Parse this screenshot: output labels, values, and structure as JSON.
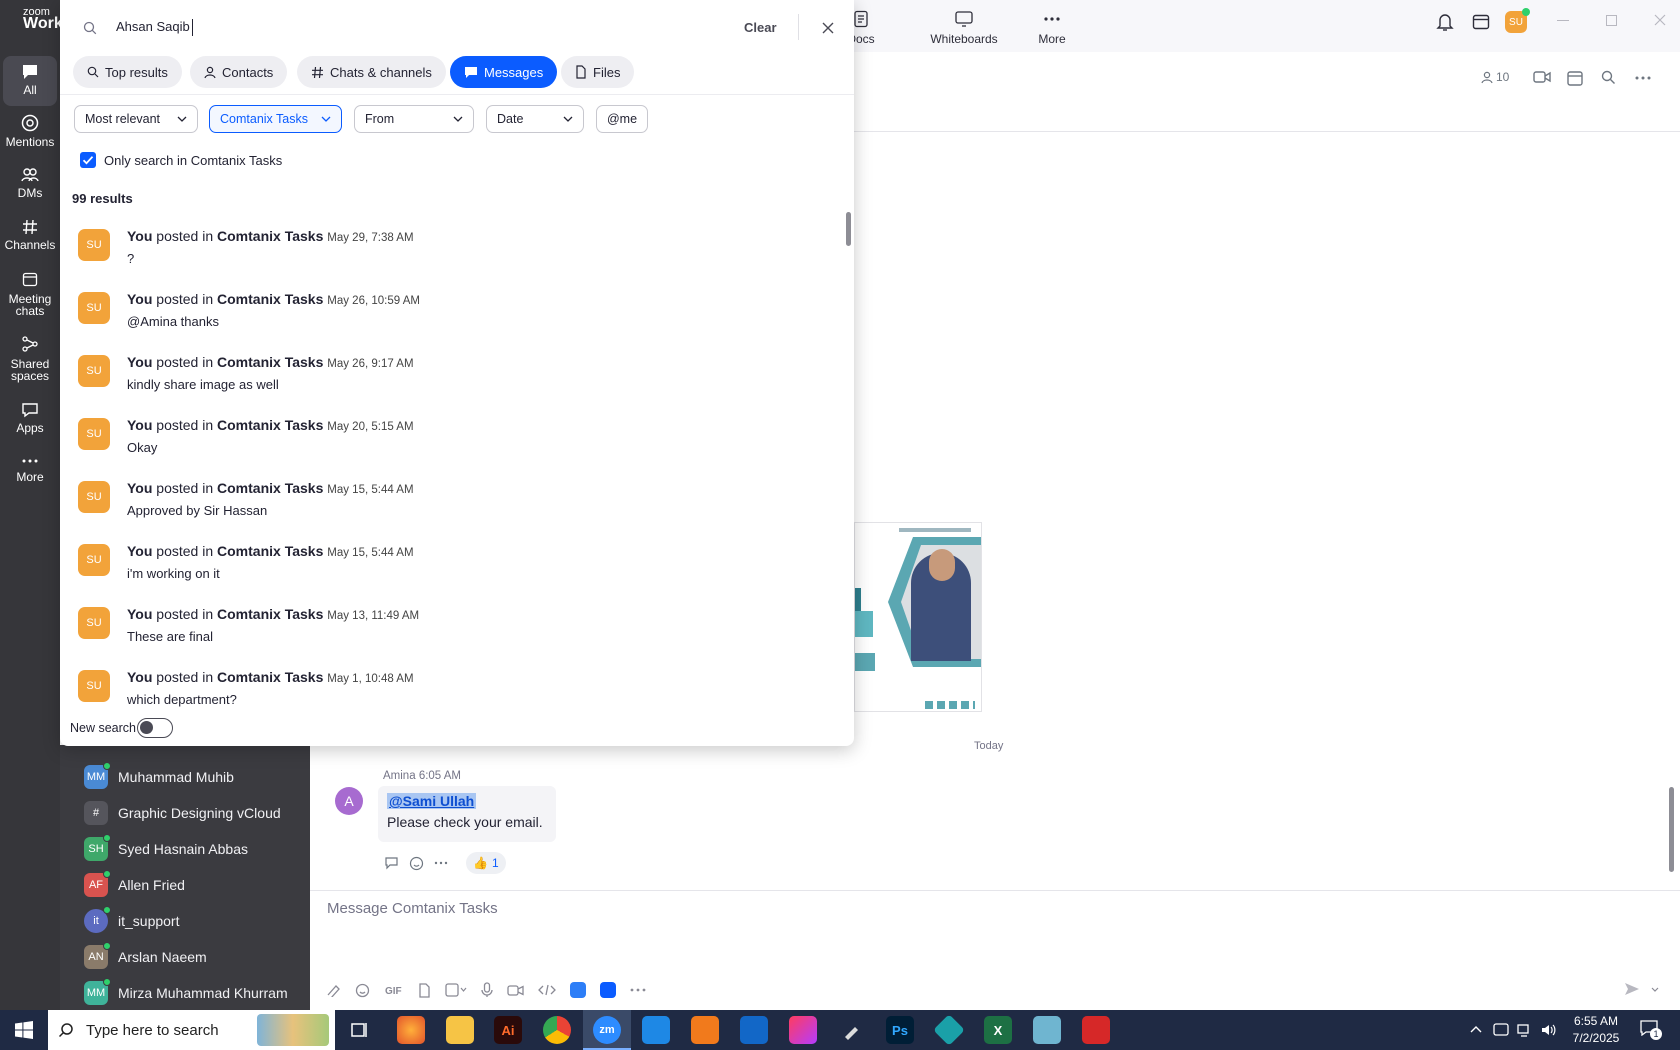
{
  "app": {
    "brand_small": "zoom",
    "brand_large": "Work"
  },
  "sidebar": {
    "items": [
      {
        "label": "All",
        "icon": "chat-bubble-icon"
      },
      {
        "label": "Mentions",
        "icon": "at-icon"
      },
      {
        "label": "DMs",
        "icon": "people-icon"
      },
      {
        "label": "Channels",
        "icon": "hash-icon"
      },
      {
        "label": "Meeting",
        "label2": "chats",
        "icon": "calendar-icon"
      },
      {
        "label": "Shared",
        "label2": "spaces",
        "icon": "share-icon"
      },
      {
        "label": "Apps",
        "icon": "apps-icon"
      },
      {
        "label": "More",
        "icon": "more-dots-icon"
      }
    ]
  },
  "topbar": {
    "docs": "Docs",
    "whiteboards": "Whiteboards",
    "more": "More",
    "avatar": "SU",
    "participants": "10"
  },
  "search": {
    "query": "Ahsan Saqib",
    "clear": "Clear",
    "tabs": [
      "Top results",
      "Contacts",
      "Chats & channels",
      "Messages",
      "Files"
    ],
    "filters": [
      "Most relevant",
      "Comtanix Tasks",
      "From",
      "Date",
      "@me"
    ],
    "only_search": "Only search in Comtanix Tasks",
    "result_count": "99 results",
    "new_search": "New search",
    "results": [
      {
        "avatar": "SU",
        "author": "You",
        "verb": "posted in",
        "channel": "Comtanix Tasks",
        "time": "May 29, 7:38 AM",
        "text": "?"
      },
      {
        "avatar": "SU",
        "author": "You",
        "verb": "posted in",
        "channel": "Comtanix Tasks",
        "time": "May 26, 10:59 AM",
        "text": "@Amina thanks"
      },
      {
        "avatar": "SU",
        "author": "You",
        "verb": "posted in",
        "channel": "Comtanix Tasks",
        "time": "May 26, 9:17 AM",
        "text": "kindly share image as well"
      },
      {
        "avatar": "SU",
        "author": "You",
        "verb": "posted in",
        "channel": "Comtanix Tasks",
        "time": "May 20, 5:15 AM",
        "text": "Okay"
      },
      {
        "avatar": "SU",
        "author": "You",
        "verb": "posted in",
        "channel": "Comtanix Tasks",
        "time": "May 15, 5:44 AM",
        "text": "Approved by Sir Hassan"
      },
      {
        "avatar": "SU",
        "author": "You",
        "verb": "posted in",
        "channel": "Comtanix Tasks",
        "time": "May 15, 5:44 AM",
        "text": "i'm working on it"
      },
      {
        "avatar": "SU",
        "author": "You",
        "verb": "posted in",
        "channel": "Comtanix Tasks",
        "time": "May 13, 11:49 AM",
        "text": "These are final"
      },
      {
        "avatar": "SU",
        "author": "You",
        "verb": "posted in",
        "channel": "Comtanix Tasks",
        "time": "May 1, 10:48 AM",
        "text": "which department?"
      }
    ]
  },
  "channels": [
    {
      "name": "Muhammad Muhib",
      "avatar": "MM",
      "color": "#4a8ad4"
    },
    {
      "name": "Graphic Designing vCloud",
      "avatar": "#",
      "color": "#55555c"
    },
    {
      "name": "Syed Hasnain Abbas",
      "avatar": "SH",
      "color": "#3fa86a"
    },
    {
      "name": "Allen Fried",
      "avatar": "AF",
      "color": "#d9534f"
    },
    {
      "name": "it_support",
      "avatar": "it",
      "color": "#5c6bc0"
    },
    {
      "name": "Arslan Naeem",
      "avatar": "AN",
      "color": "#8a7b6a"
    },
    {
      "name": "Mirza Muhammad Khurram",
      "avatar": "MM",
      "color": "#3fb39a"
    }
  ],
  "chat": {
    "date_divider": "Today",
    "message": {
      "author": "Amina",
      "time": "6:05 AM",
      "avatar": "A",
      "mention": "@Sami Ullah",
      "text": "Please check your email.",
      "reaction": "👍",
      "reaction_count": "1"
    },
    "composer_placeholder": "Message Comtanix Tasks"
  },
  "taskbar": {
    "search_placeholder": "Type here to search",
    "time": "6:55 AM",
    "date": "7/2/2025",
    "notif": "1"
  }
}
